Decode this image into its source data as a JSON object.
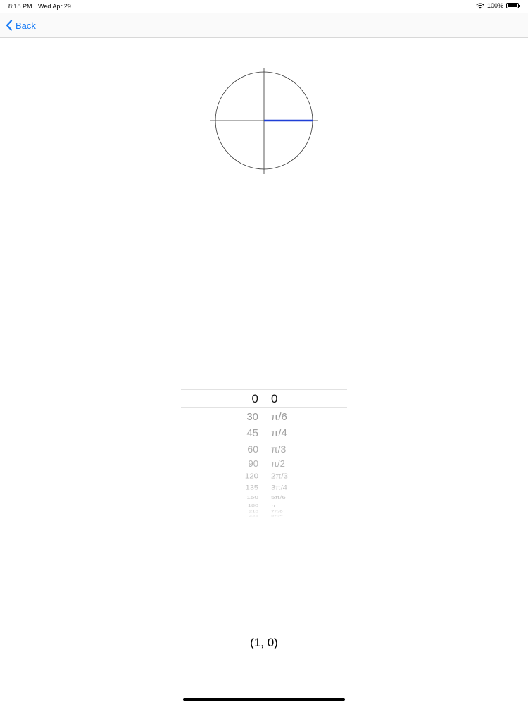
{
  "status_bar": {
    "time": "8:18 PM",
    "date": "Wed Apr 29",
    "battery": "100%"
  },
  "nav": {
    "back_label": "Back"
  },
  "picker": {
    "selected": {
      "degrees": "0",
      "radians": "0"
    },
    "rows": [
      {
        "degrees": "30",
        "radians": "π/6"
      },
      {
        "degrees": "45",
        "radians": "π/4"
      },
      {
        "degrees": "60",
        "radians": "π/3"
      },
      {
        "degrees": "90",
        "radians": "π/2"
      },
      {
        "degrees": "120",
        "radians": "2π/3"
      },
      {
        "degrees": "135",
        "radians": "3π/4"
      },
      {
        "degrees": "150",
        "radians": "5π/6"
      },
      {
        "degrees": "180",
        "radians": "π"
      },
      {
        "degrees": "210",
        "radians": "7π/6"
      },
      {
        "degrees": "225",
        "radians": "5π/4"
      }
    ]
  },
  "coordinates": "(1, 0)",
  "colors": {
    "accent": "#1a7cf5",
    "angle_line": "#1f3fd6"
  }
}
